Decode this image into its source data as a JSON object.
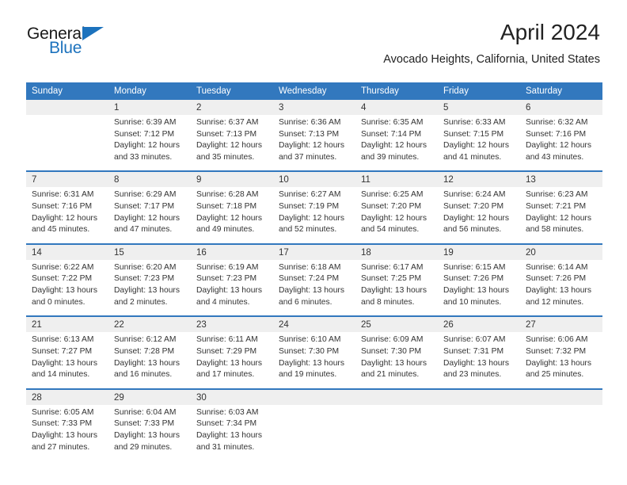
{
  "brand": {
    "word_one": "General",
    "word_two": "Blue",
    "accent_color": "#1c72bd",
    "logo_icon": "triangle-icon"
  },
  "header": {
    "title": "April 2024",
    "subtitle": "Avocado Heights, California, United States"
  },
  "calendar": {
    "header_color": "#3278be",
    "daynum_band_color": "#efefef",
    "weekday_headers": [
      "Sunday",
      "Monday",
      "Tuesday",
      "Wednesday",
      "Thursday",
      "Friday",
      "Saturday"
    ],
    "weeks": [
      {
        "days": [
          {
            "day": "",
            "sunrise": "",
            "sunset": "",
            "daylight_line1": "",
            "daylight_line2": ""
          },
          {
            "day": "1",
            "sunrise": "Sunrise: 6:39 AM",
            "sunset": "Sunset: 7:12 PM",
            "daylight_line1": "Daylight: 12 hours",
            "daylight_line2": "and 33 minutes."
          },
          {
            "day": "2",
            "sunrise": "Sunrise: 6:37 AM",
            "sunset": "Sunset: 7:13 PM",
            "daylight_line1": "Daylight: 12 hours",
            "daylight_line2": "and 35 minutes."
          },
          {
            "day": "3",
            "sunrise": "Sunrise: 6:36 AM",
            "sunset": "Sunset: 7:13 PM",
            "daylight_line1": "Daylight: 12 hours",
            "daylight_line2": "and 37 minutes."
          },
          {
            "day": "4",
            "sunrise": "Sunrise: 6:35 AM",
            "sunset": "Sunset: 7:14 PM",
            "daylight_line1": "Daylight: 12 hours",
            "daylight_line2": "and 39 minutes."
          },
          {
            "day": "5",
            "sunrise": "Sunrise: 6:33 AM",
            "sunset": "Sunset: 7:15 PM",
            "daylight_line1": "Daylight: 12 hours",
            "daylight_line2": "and 41 minutes."
          },
          {
            "day": "6",
            "sunrise": "Sunrise: 6:32 AM",
            "sunset": "Sunset: 7:16 PM",
            "daylight_line1": "Daylight: 12 hours",
            "daylight_line2": "and 43 minutes."
          }
        ]
      },
      {
        "days": [
          {
            "day": "7",
            "sunrise": "Sunrise: 6:31 AM",
            "sunset": "Sunset: 7:16 PM",
            "daylight_line1": "Daylight: 12 hours",
            "daylight_line2": "and 45 minutes."
          },
          {
            "day": "8",
            "sunrise": "Sunrise: 6:29 AM",
            "sunset": "Sunset: 7:17 PM",
            "daylight_line1": "Daylight: 12 hours",
            "daylight_line2": "and 47 minutes."
          },
          {
            "day": "9",
            "sunrise": "Sunrise: 6:28 AM",
            "sunset": "Sunset: 7:18 PM",
            "daylight_line1": "Daylight: 12 hours",
            "daylight_line2": "and 49 minutes."
          },
          {
            "day": "10",
            "sunrise": "Sunrise: 6:27 AM",
            "sunset": "Sunset: 7:19 PM",
            "daylight_line1": "Daylight: 12 hours",
            "daylight_line2": "and 52 minutes."
          },
          {
            "day": "11",
            "sunrise": "Sunrise: 6:25 AM",
            "sunset": "Sunset: 7:20 PM",
            "daylight_line1": "Daylight: 12 hours",
            "daylight_line2": "and 54 minutes."
          },
          {
            "day": "12",
            "sunrise": "Sunrise: 6:24 AM",
            "sunset": "Sunset: 7:20 PM",
            "daylight_line1": "Daylight: 12 hours",
            "daylight_line2": "and 56 minutes."
          },
          {
            "day": "13",
            "sunrise": "Sunrise: 6:23 AM",
            "sunset": "Sunset: 7:21 PM",
            "daylight_line1": "Daylight: 12 hours",
            "daylight_line2": "and 58 minutes."
          }
        ]
      },
      {
        "days": [
          {
            "day": "14",
            "sunrise": "Sunrise: 6:22 AM",
            "sunset": "Sunset: 7:22 PM",
            "daylight_line1": "Daylight: 13 hours",
            "daylight_line2": "and 0 minutes."
          },
          {
            "day": "15",
            "sunrise": "Sunrise: 6:20 AM",
            "sunset": "Sunset: 7:23 PM",
            "daylight_line1": "Daylight: 13 hours",
            "daylight_line2": "and 2 minutes."
          },
          {
            "day": "16",
            "sunrise": "Sunrise: 6:19 AM",
            "sunset": "Sunset: 7:23 PM",
            "daylight_line1": "Daylight: 13 hours",
            "daylight_line2": "and 4 minutes."
          },
          {
            "day": "17",
            "sunrise": "Sunrise: 6:18 AM",
            "sunset": "Sunset: 7:24 PM",
            "daylight_line1": "Daylight: 13 hours",
            "daylight_line2": "and 6 minutes."
          },
          {
            "day": "18",
            "sunrise": "Sunrise: 6:17 AM",
            "sunset": "Sunset: 7:25 PM",
            "daylight_line1": "Daylight: 13 hours",
            "daylight_line2": "and 8 minutes."
          },
          {
            "day": "19",
            "sunrise": "Sunrise: 6:15 AM",
            "sunset": "Sunset: 7:26 PM",
            "daylight_line1": "Daylight: 13 hours",
            "daylight_line2": "and 10 minutes."
          },
          {
            "day": "20",
            "sunrise": "Sunrise: 6:14 AM",
            "sunset": "Sunset: 7:26 PM",
            "daylight_line1": "Daylight: 13 hours",
            "daylight_line2": "and 12 minutes."
          }
        ]
      },
      {
        "days": [
          {
            "day": "21",
            "sunrise": "Sunrise: 6:13 AM",
            "sunset": "Sunset: 7:27 PM",
            "daylight_line1": "Daylight: 13 hours",
            "daylight_line2": "and 14 minutes."
          },
          {
            "day": "22",
            "sunrise": "Sunrise: 6:12 AM",
            "sunset": "Sunset: 7:28 PM",
            "daylight_line1": "Daylight: 13 hours",
            "daylight_line2": "and 16 minutes."
          },
          {
            "day": "23",
            "sunrise": "Sunrise: 6:11 AM",
            "sunset": "Sunset: 7:29 PM",
            "daylight_line1": "Daylight: 13 hours",
            "daylight_line2": "and 17 minutes."
          },
          {
            "day": "24",
            "sunrise": "Sunrise: 6:10 AM",
            "sunset": "Sunset: 7:30 PM",
            "daylight_line1": "Daylight: 13 hours",
            "daylight_line2": "and 19 minutes."
          },
          {
            "day": "25",
            "sunrise": "Sunrise: 6:09 AM",
            "sunset": "Sunset: 7:30 PM",
            "daylight_line1": "Daylight: 13 hours",
            "daylight_line2": "and 21 minutes."
          },
          {
            "day": "26",
            "sunrise": "Sunrise: 6:07 AM",
            "sunset": "Sunset: 7:31 PM",
            "daylight_line1": "Daylight: 13 hours",
            "daylight_line2": "and 23 minutes."
          },
          {
            "day": "27",
            "sunrise": "Sunrise: 6:06 AM",
            "sunset": "Sunset: 7:32 PM",
            "daylight_line1": "Daylight: 13 hours",
            "daylight_line2": "and 25 minutes."
          }
        ]
      },
      {
        "days": [
          {
            "day": "28",
            "sunrise": "Sunrise: 6:05 AM",
            "sunset": "Sunset: 7:33 PM",
            "daylight_line1": "Daylight: 13 hours",
            "daylight_line2": "and 27 minutes."
          },
          {
            "day": "29",
            "sunrise": "Sunrise: 6:04 AM",
            "sunset": "Sunset: 7:33 PM",
            "daylight_line1": "Daylight: 13 hours",
            "daylight_line2": "and 29 minutes."
          },
          {
            "day": "30",
            "sunrise": "Sunrise: 6:03 AM",
            "sunset": "Sunset: 7:34 PM",
            "daylight_line1": "Daylight: 13 hours",
            "daylight_line2": "and 31 minutes."
          },
          {
            "day": "",
            "sunrise": "",
            "sunset": "",
            "daylight_line1": "",
            "daylight_line2": ""
          },
          {
            "day": "",
            "sunrise": "",
            "sunset": "",
            "daylight_line1": "",
            "daylight_line2": ""
          },
          {
            "day": "",
            "sunrise": "",
            "sunset": "",
            "daylight_line1": "",
            "daylight_line2": ""
          },
          {
            "day": "",
            "sunrise": "",
            "sunset": "",
            "daylight_line1": "",
            "daylight_line2": ""
          }
        ]
      }
    ]
  }
}
